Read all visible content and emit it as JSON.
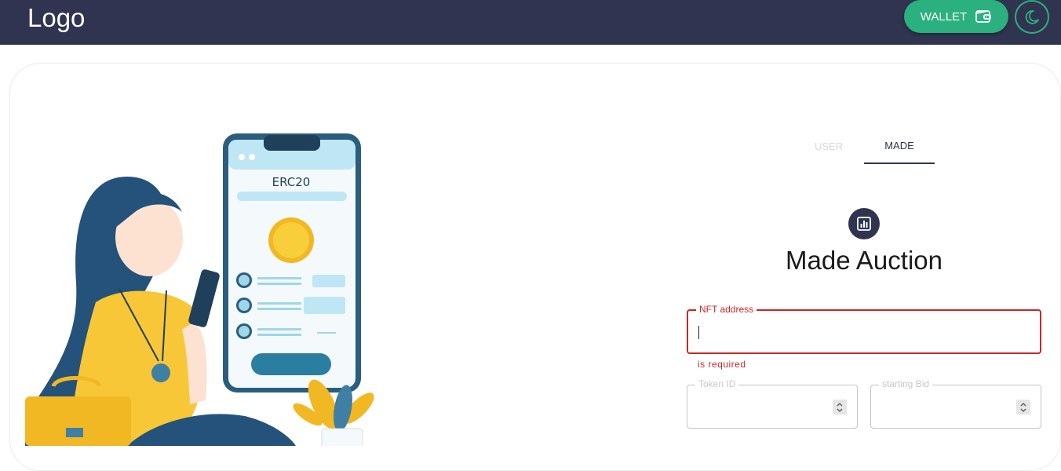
{
  "header": {
    "logo": "Logo",
    "wallet_label": "WALLET",
    "wallet_icon": "wallet-icon",
    "theme_icon": "moon-icon"
  },
  "illustration": {
    "phone_title": "ERC20"
  },
  "tabs": [
    {
      "label": "USER",
      "active": false
    },
    {
      "label": "MADE",
      "active": true
    }
  ],
  "form": {
    "icon": "bar-chart-icon",
    "title": "Made Auction",
    "nft_address": {
      "label": "NFT address",
      "value": "",
      "error": "is required"
    },
    "token_id": {
      "label": "Token ID",
      "value": ""
    },
    "starting_bid": {
      "label": "starting Bid",
      "value": ""
    }
  },
  "colors": {
    "header_bg": "#303450",
    "accent": "#2bb07f",
    "error": "#c62828"
  }
}
